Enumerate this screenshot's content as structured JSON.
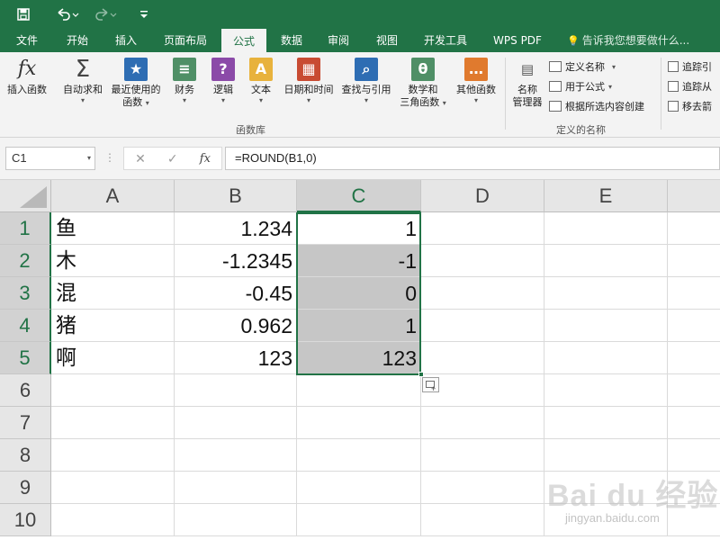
{
  "quick_access": {
    "save_icon": "save-icon",
    "undo_icon": "undo-icon",
    "redo_icon": "redo-icon",
    "customize_icon": "customize-qat-icon"
  },
  "tabs": [
    "文件",
    "开始",
    "插入",
    "页面布局",
    "公式",
    "数据",
    "审阅",
    "视图",
    "开发工具",
    "WPS PDF"
  ],
  "active_tab": "公式",
  "tell_me": "告诉我您想要做什么...",
  "ribbon": {
    "insert_function": "插入函数",
    "autosum": [
      "自动求和"
    ],
    "recent": [
      "最近使用的",
      "函数"
    ],
    "financial": [
      "财务"
    ],
    "logical": [
      "逻辑"
    ],
    "text": [
      "文本"
    ],
    "datetime": [
      "日期和时间"
    ],
    "lookup": [
      "查找与引用"
    ],
    "math": [
      "数学和",
      "三角函数"
    ],
    "more": [
      "其他函数"
    ],
    "library_label": "函数库",
    "name_manager": [
      "名称",
      "管理器"
    ],
    "define_name": "定义名称",
    "use_in_formula": "用于公式",
    "create_from_selection": "根据所选内容创建",
    "defined_names_label": "定义的名称",
    "trace_precedents": "追踪引",
    "trace_dependents": "追踪从",
    "remove_arrows": "移去箭"
  },
  "formula_bar": {
    "name_box": "C1",
    "dots": "⋮",
    "cancel": "✕",
    "enter": "✓",
    "fx": "fx",
    "formula": "=ROUND(B1,0)"
  },
  "columns": [
    "A",
    "B",
    "C",
    "D",
    "E"
  ],
  "rows": [
    "1",
    "2",
    "3",
    "4",
    "5",
    "6",
    "7",
    "8",
    "9",
    "10"
  ],
  "cells": {
    "a": [
      "鱼",
      "木",
      "混",
      "猪",
      "啊"
    ],
    "b": [
      "1.234",
      "-1.2345",
      "-0.45",
      "0.962",
      "123"
    ],
    "c": [
      "1",
      "-1",
      "0",
      "1",
      "123"
    ]
  },
  "watermark": {
    "main": "Bai du 经验",
    "sub": "jingyan.baidu.com"
  }
}
